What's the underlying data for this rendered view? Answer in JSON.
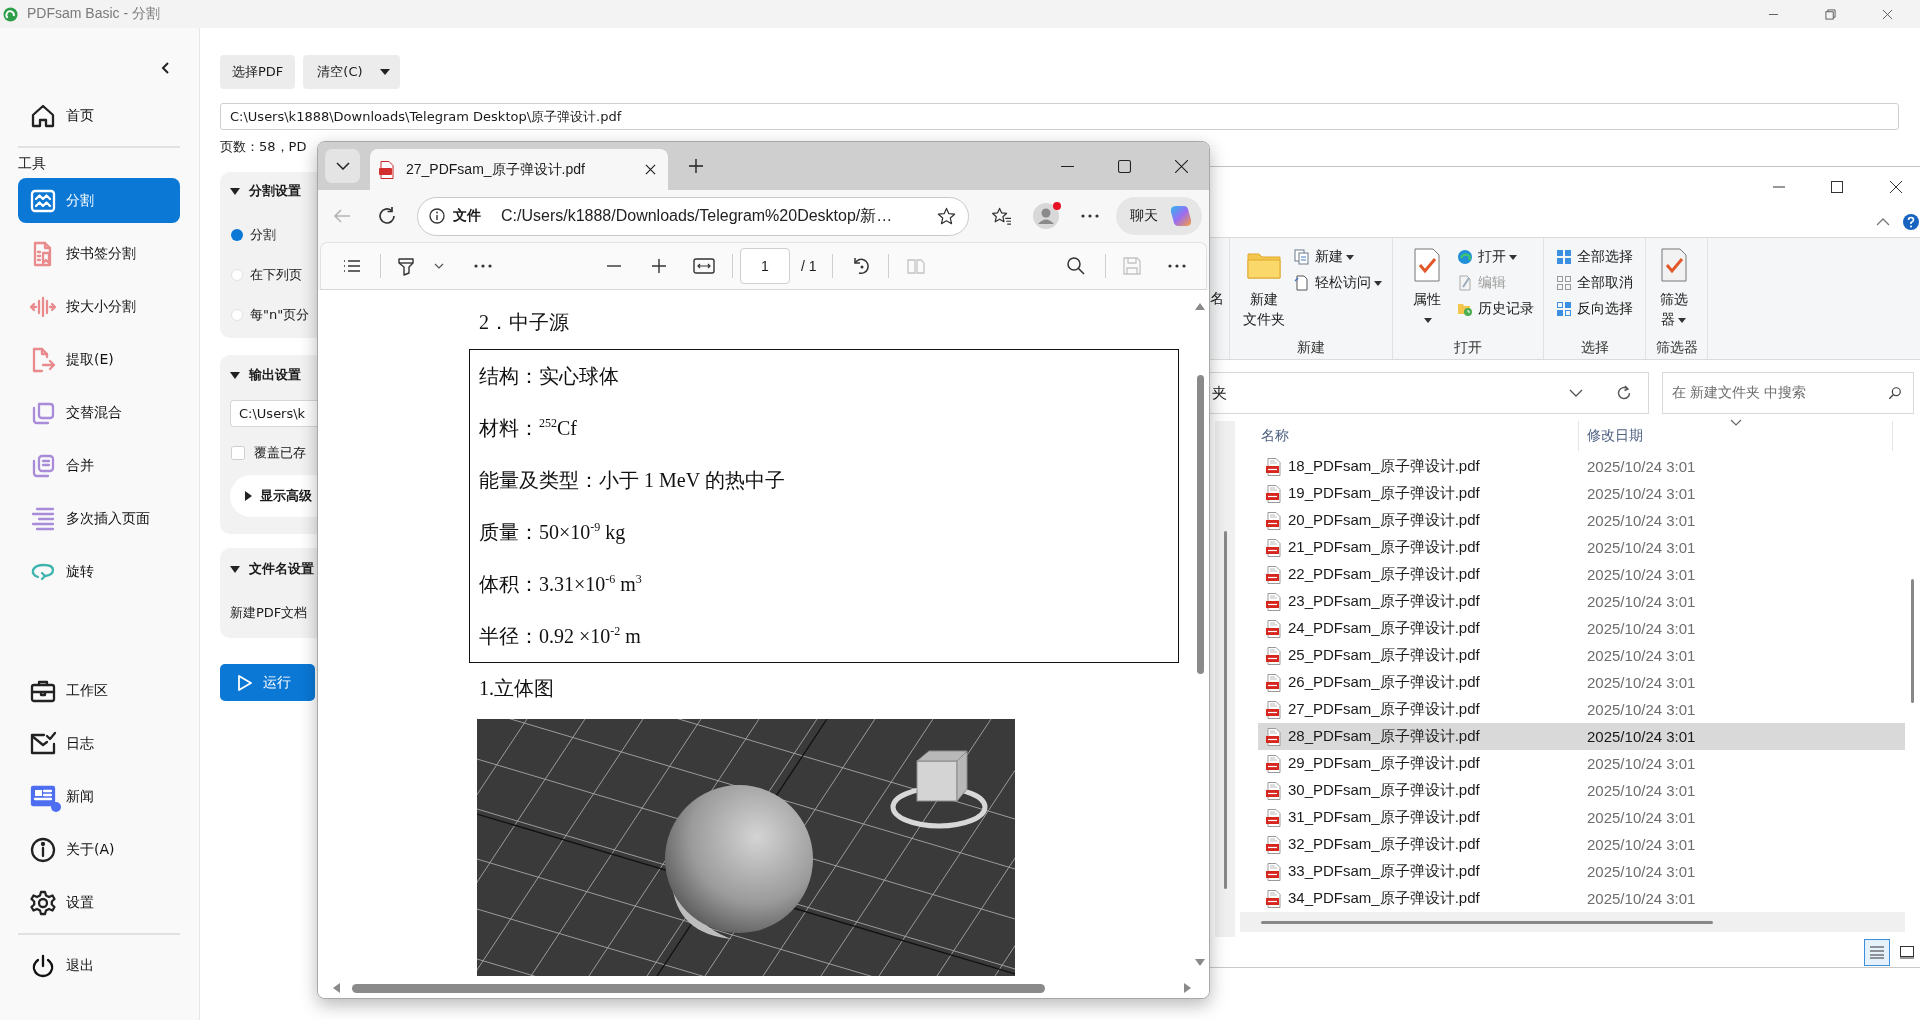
{
  "pdfsam": {
    "window": {
      "title": "PDFsam Basic - 分割"
    },
    "sidebar": {
      "top_items": [
        {
          "label": "首页",
          "selected": false
        }
      ],
      "tools_heading": "工具",
      "tools": [
        {
          "label": "分割",
          "selected": true
        },
        {
          "label": "按书签分割",
          "selected": false
        },
        {
          "label": "按大小分割",
          "selected": false
        },
        {
          "label": "提取(E)",
          "selected": false
        },
        {
          "label": "交替混合",
          "selected": false
        },
        {
          "label": "合并",
          "selected": false
        },
        {
          "label": "多次插入页面",
          "selected": false
        },
        {
          "label": "旋转",
          "selected": false
        }
      ],
      "bottom_items": [
        {
          "label": "工作区",
          "selected": false,
          "notification": false
        },
        {
          "label": "日志",
          "selected": false,
          "notification": false
        },
        {
          "label": "新闻",
          "selected": false,
          "notification": true
        },
        {
          "label": "关于(A)",
          "selected": false,
          "notification": false
        },
        {
          "label": "设置",
          "selected": false,
          "notification": false
        }
      ],
      "exit_item": {
        "label": "退出"
      }
    },
    "toolbar": {
      "buttons": [
        {
          "label": "选择PDF",
          "has_menu": false
        },
        {
          "label": "清空(C)",
          "has_menu": true
        }
      ]
    },
    "file_path": "C:\\Users\\k1888\\Downloads\\Telegram Desktop\\原子弹设计.pdf",
    "page_info": "页数：58，PD",
    "split_settings": {
      "title": "分割设置",
      "expanded": true,
      "options": [
        {
          "label": "分割",
          "selected": true
        },
        {
          "label": "在下列页",
          "selected": false
        },
        {
          "label": "每\"n\"页分",
          "selected": false
        }
      ]
    },
    "output_settings": {
      "title": "输出设置",
      "expanded": true,
      "directory": "C:\\Users\\k",
      "overwrite": {
        "label": "覆盖已存",
        "checked": false
      },
      "advanced": {
        "label": "显示高级",
        "expanded": false
      }
    },
    "filename_settings": {
      "title": "文件名设置",
      "expanded": true,
      "prefix_label": "新建PDF文档"
    },
    "run_button": {
      "label": "运行"
    }
  },
  "browser": {
    "tabs": [
      {
        "title": "27_PDFsam_原子弹设计.pdf",
        "selected": true
      }
    ],
    "address_bar": {
      "scheme": "文件",
      "url": "C:/Users/k1888/Downloads/Telegram%20Desktop/新…"
    },
    "profile": {
      "notification": true
    },
    "chat_button": {
      "label": "聊天"
    },
    "pdf_toolbar": {
      "page": "1",
      "page_count": "/ 1"
    },
    "document": {
      "heading": "2．中子源",
      "table_rows": [
        "结构：实心球体",
        "材料：$^{252}$Cf",
        "能量及类型：小于 1 MeV 的热中子",
        "质量：50×10$^{-9}$ kg",
        "体积：3.31×10$^{-6}$ m$^{3}$",
        "半径：0.92 ×10$^{-2}$ m"
      ],
      "subheading": "1.立体图"
    }
  },
  "explorer": {
    "ribbon": {
      "cut_item": {
        "label": "名"
      },
      "groups": [
        {
          "label": "新建",
          "items": [
            {
              "kind": "large",
              "label": "新建文件夹",
              "has_menu": false,
              "disabled": false
            },
            {
              "kind": "small",
              "label": "新建",
              "has_menu": true,
              "disabled": false
            },
            {
              "kind": "small",
              "label": "轻松访问",
              "has_menu": true,
              "disabled": false
            }
          ]
        },
        {
          "label": "打开",
          "items": [
            {
              "kind": "large",
              "label": "属性",
              "has_menu": true,
              "disabled": false
            },
            {
              "kind": "small",
              "label": "打开",
              "has_menu": true,
              "disabled": false
            },
            {
              "kind": "small",
              "label": "编辑",
              "has_menu": false,
              "disabled": true
            },
            {
              "kind": "small",
              "label": "历史记录",
              "has_menu": false,
              "disabled": false
            }
          ]
        },
        {
          "label": "选择",
          "items": [
            {
              "kind": "small",
              "label": "全部选择",
              "has_menu": false,
              "disabled": false
            },
            {
              "kind": "small",
              "label": "全部取消",
              "has_menu": false,
              "disabled": false
            },
            {
              "kind": "small",
              "label": "反向选择",
              "has_menu": false,
              "disabled": false
            }
          ]
        },
        {
          "label": "筛选器",
          "items": [
            {
              "kind": "large",
              "label": "筛选器",
              "has_menu": true,
              "disabled": false
            }
          ]
        }
      ]
    },
    "address": {
      "path": "夹"
    },
    "search": {
      "placeholder": "在 新建文件夹 中搜索"
    },
    "columns": [
      {
        "label": "名称",
        "sorted": false
      },
      {
        "label": "修改日期",
        "sorted": true
      }
    ],
    "rows": [
      {
        "name": "18_PDFsam_原子弹设计.pdf",
        "modified": "2025/10/24 3:01",
        "selected": false
      },
      {
        "name": "19_PDFsam_原子弹设计.pdf",
        "modified": "2025/10/24 3:01",
        "selected": false
      },
      {
        "name": "20_PDFsam_原子弹设计.pdf",
        "modified": "2025/10/24 3:01",
        "selected": false
      },
      {
        "name": "21_PDFsam_原子弹设计.pdf",
        "modified": "2025/10/24 3:01",
        "selected": false
      },
      {
        "name": "22_PDFsam_原子弹设计.pdf",
        "modified": "2025/10/24 3:01",
        "selected": false
      },
      {
        "name": "23_PDFsam_原子弹设计.pdf",
        "modified": "2025/10/24 3:01",
        "selected": false
      },
      {
        "name": "24_PDFsam_原子弹设计.pdf",
        "modified": "2025/10/24 3:01",
        "selected": false
      },
      {
        "name": "25_PDFsam_原子弹设计.pdf",
        "modified": "2025/10/24 3:01",
        "selected": false
      },
      {
        "name": "26_PDFsam_原子弹设计.pdf",
        "modified": "2025/10/24 3:01",
        "selected": false
      },
      {
        "name": "27_PDFsam_原子弹设计.pdf",
        "modified": "2025/10/24 3:01",
        "selected": false
      },
      {
        "name": "28_PDFsam_原子弹设计.pdf",
        "modified": "2025/10/24 3:01",
        "selected": true
      },
      {
        "name": "29_PDFsam_原子弹设计.pdf",
        "modified": "2025/10/24 3:01",
        "selected": false
      },
      {
        "name": "30_PDFsam_原子弹设计.pdf",
        "modified": "2025/10/24 3:01",
        "selected": false
      },
      {
        "name": "31_PDFsam_原子弹设计.pdf",
        "modified": "2025/10/24 3:01",
        "selected": false
      },
      {
        "name": "32_PDFsam_原子弹设计.pdf",
        "modified": "2025/10/24 3:01",
        "selected": false
      },
      {
        "name": "33_PDFsam_原子弹设计.pdf",
        "modified": "2025/10/24 3:01",
        "selected": false
      },
      {
        "name": "34_PDFsam_原子弹设计.pdf",
        "modified": "2025/10/24 3:01",
        "selected": false
      }
    ],
    "views": [
      {
        "kind": "details",
        "selected": true
      },
      {
        "kind": "tiles",
        "selected": false
      }
    ]
  }
}
